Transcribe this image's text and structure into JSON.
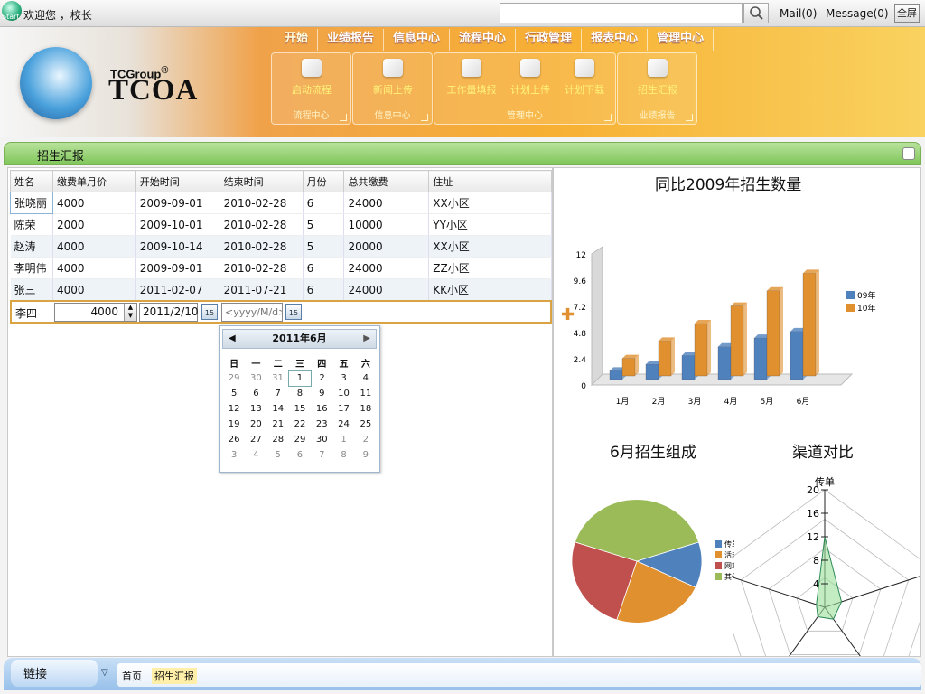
{
  "topbar": {
    "start_label": "Start",
    "welcome": "欢迎您 ，校长",
    "search_placeholder": "",
    "mail": "Mail(0)",
    "message": "Message(0)",
    "fullscreen": "全屏"
  },
  "brand": {
    "group": "TCGroup",
    "reg": "®",
    "name": "TCOA"
  },
  "nav": [
    "开始",
    "业绩报告",
    "信息中心",
    "流程中心",
    "行政管理",
    "报表中心",
    "管理中心"
  ],
  "toolbar": {
    "groups": [
      {
        "title": "流程中心",
        "tools": [
          "启动流程"
        ]
      },
      {
        "title": "信息中心",
        "tools": [
          "新闻上传"
        ]
      },
      {
        "title": "管理中心",
        "tools": [
          "工作量填报",
          "计划上传",
          "计划下载"
        ]
      },
      {
        "title": "业绩报告",
        "tools": [
          "招生汇报"
        ]
      }
    ]
  },
  "panel": {
    "title": "招生汇报"
  },
  "grid": {
    "columns": [
      "姓名",
      "缴费单月价",
      "开始时间",
      "结束时间",
      "月份",
      "总共缴费",
      "住址"
    ],
    "rows": [
      [
        "张晓丽",
        "4000",
        "2009-09-01",
        "2010-02-28",
        "6",
        "24000",
        "XX小区"
      ],
      [
        "陈荣",
        "2000",
        "2009-10-01",
        "2010-02-28",
        "5",
        "10000",
        "YY小区"
      ],
      [
        "赵涛",
        "4000",
        "2009-10-14",
        "2010-02-28",
        "5",
        "20000",
        "XX小区"
      ],
      [
        "李明伟",
        "4000",
        "2009-09-01",
        "2010-02-28",
        "6",
        "24000",
        "ZZ小区"
      ],
      [
        "张三",
        "4000",
        "2011-02-07",
        "2011-07-21",
        "6",
        "24000",
        "KK小区"
      ]
    ],
    "edit_row": {
      "name": "李四",
      "price": "4000",
      "start_date": "2011/2/10",
      "end_placeholder": "<yyyy/M/d>",
      "cal_icon": "15"
    }
  },
  "calendar": {
    "month_label": "2011年6月",
    "weekdays": [
      "日",
      "一",
      "二",
      "三",
      "四",
      "五",
      "六"
    ],
    "weeks": [
      [
        "29",
        "30",
        "31",
        "1",
        "2",
        "3",
        "4"
      ],
      [
        "5",
        "6",
        "7",
        "8",
        "9",
        "10",
        "11"
      ],
      [
        "12",
        "13",
        "14",
        "15",
        "16",
        "17",
        "18"
      ],
      [
        "19",
        "20",
        "21",
        "22",
        "23",
        "24",
        "25"
      ],
      [
        "26",
        "27",
        "28",
        "29",
        "30",
        "1",
        "2"
      ],
      [
        "3",
        "4",
        "5",
        "6",
        "7",
        "8",
        "9"
      ]
    ]
  },
  "colors": {
    "s09": "#4f81bd",
    "s10": "#e0902f",
    "accent": "#f7b033"
  },
  "chart_data": [
    {
      "type": "bar",
      "title": "同比2009年招生数量",
      "categories": [
        "1月",
        "2月",
        "3月",
        "4月",
        "5月",
        "6月"
      ],
      "series": [
        {
          "name": "09年",
          "values": [
            0.8,
            1.4,
            2.2,
            3.0,
            3.8,
            4.4
          ]
        },
        {
          "name": "10年",
          "values": [
            1.6,
            3.2,
            4.8,
            6.4,
            7.8,
            9.4
          ]
        }
      ],
      "ylim": [
        0,
        12
      ],
      "yticks": [
        "0",
        "2.4",
        "4.8",
        "7.2",
        "9.6",
        "12"
      ],
      "legend": "right"
    },
    {
      "type": "pie",
      "title": "6月招生组成",
      "labels": [
        "传单",
        "活动",
        "网站",
        "其他"
      ],
      "values": [
        12,
        23,
        25,
        40
      ],
      "colors": [
        "#4f81bd",
        "#e0902f",
        "#c0504d",
        "#9bbb59"
      ],
      "legend": "right"
    },
    {
      "type": "radar",
      "title": "渠道对比",
      "axes": [
        "传单",
        "",
        "",
        "",
        ""
      ],
      "values": [
        12,
        3,
        2.5,
        2,
        1.5
      ],
      "rlim": [
        0,
        20
      ],
      "ticks": [
        "4",
        "8",
        "12",
        "16",
        "20"
      ]
    }
  ],
  "footer": {
    "links_label": "链接",
    "crumb_home": "首页",
    "crumb_current": "招生汇报"
  }
}
